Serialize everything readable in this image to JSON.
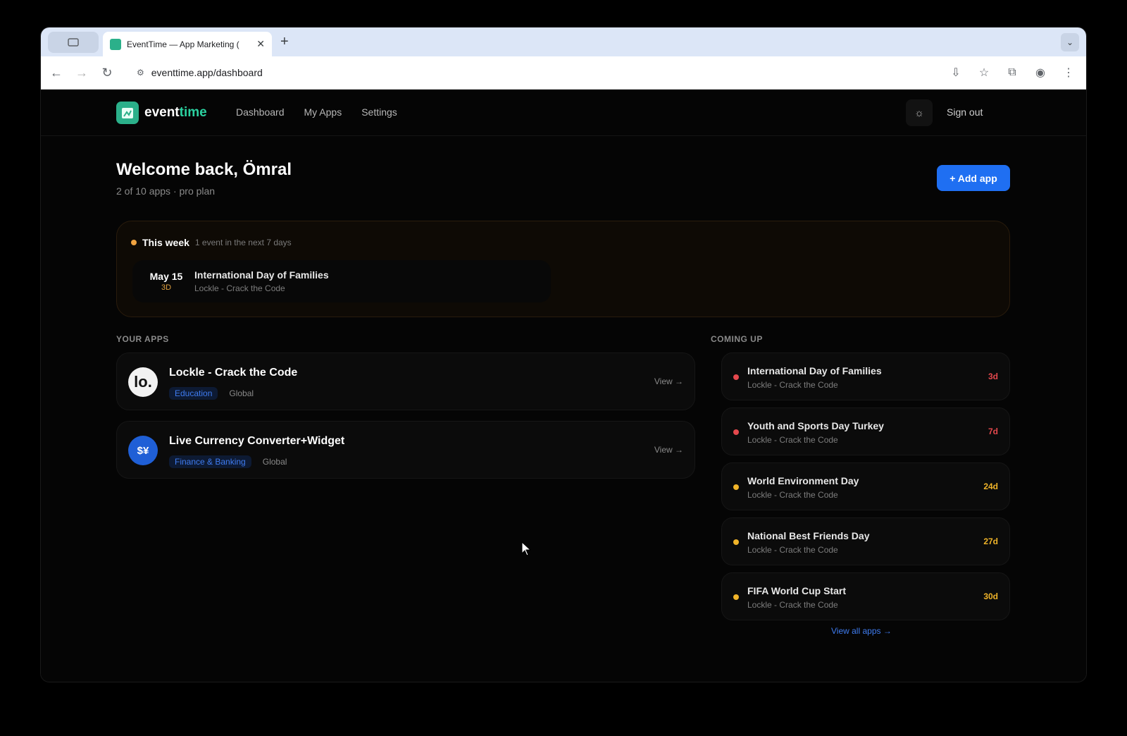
{
  "browser": {
    "tab_title": "EventTime — App Marketing (",
    "url": "eventtime.app/dashboard"
  },
  "nav": {
    "logo_main": "event",
    "logo_accent": "time",
    "links": [
      "Dashboard",
      "My Apps",
      "Settings"
    ],
    "sign_out": "Sign out"
  },
  "header": {
    "welcome": "Welcome back, Ömral",
    "subline": "2 of 10 apps · pro plan",
    "add_button": "+ Add app"
  },
  "this_week": {
    "title": "This week",
    "subtitle": "1 event in the next 7 days",
    "event": {
      "date": "May 15",
      "days": "3D",
      "name": "International Day of Families",
      "app": "Lockle - Crack the Code"
    }
  },
  "your_apps": {
    "label": "YOUR APPS",
    "view_label": "View →",
    "items": [
      {
        "name": "Lockle - Crack the Code",
        "category": "Education",
        "region": "Global"
      },
      {
        "name": "Live Currency Converter+Widget",
        "category": "Finance & Banking",
        "region": "Global"
      }
    ]
  },
  "coming_up": {
    "label": "COMING UP",
    "items": [
      {
        "name": "International Day of Families",
        "app": "Lockle - Crack the Code",
        "days": "3d",
        "color": "#e5484d"
      },
      {
        "name": "Youth and Sports Day Turkey",
        "app": "Lockle - Crack the Code",
        "days": "7d",
        "color": "#e5484d"
      },
      {
        "name": "World Environment Day",
        "app": "Lockle - Crack the Code",
        "days": "24d",
        "color": "#f0b429"
      },
      {
        "name": "National Best Friends Day",
        "app": "Lockle - Crack the Code",
        "days": "27d",
        "color": "#f0b429"
      },
      {
        "name": "FIFA World Cup Start",
        "app": "Lockle - Crack the Code",
        "days": "30d",
        "color": "#f0b429"
      }
    ],
    "view_all": "View all apps →"
  }
}
